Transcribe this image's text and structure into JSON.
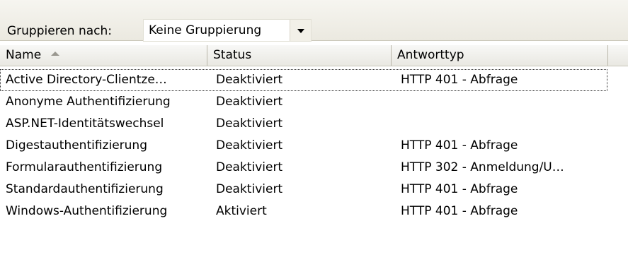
{
  "toolbar": {
    "group_by_label": "Gruppieren nach:",
    "group_by_value": "Keine Gruppierung",
    "dropdown_icon": "chevron-down-icon"
  },
  "columns": [
    {
      "label": "Name",
      "sorted": "ascending"
    },
    {
      "label": "Status"
    },
    {
      "label": "Antworttyp"
    }
  ],
  "rows": [
    {
      "name": "Active Directory-Clientze…",
      "status": "Deaktiviert",
      "response": "HTTP 401 - Abfrage",
      "selected": true
    },
    {
      "name": "Anonyme Authentifizierung",
      "status": "Deaktiviert",
      "response": ""
    },
    {
      "name": "ASP.NET-Identitätswechsel",
      "status": "Deaktiviert",
      "response": ""
    },
    {
      "name": "Digestauthentifizierung",
      "status": "Deaktiviert",
      "response": "HTTP 401 - Abfrage"
    },
    {
      "name": "Formularauthentifizierung",
      "status": "Deaktiviert",
      "response": "HTTP 302 - Anmeldung/U…"
    },
    {
      "name": "Standardauthentifizierung",
      "status": "Deaktiviert",
      "response": "HTTP 401 - Abfrage"
    },
    {
      "name": "Windows-Authentifizierung",
      "status": "Aktiviert",
      "response": "HTTP 401 - Abfrage"
    }
  ]
}
